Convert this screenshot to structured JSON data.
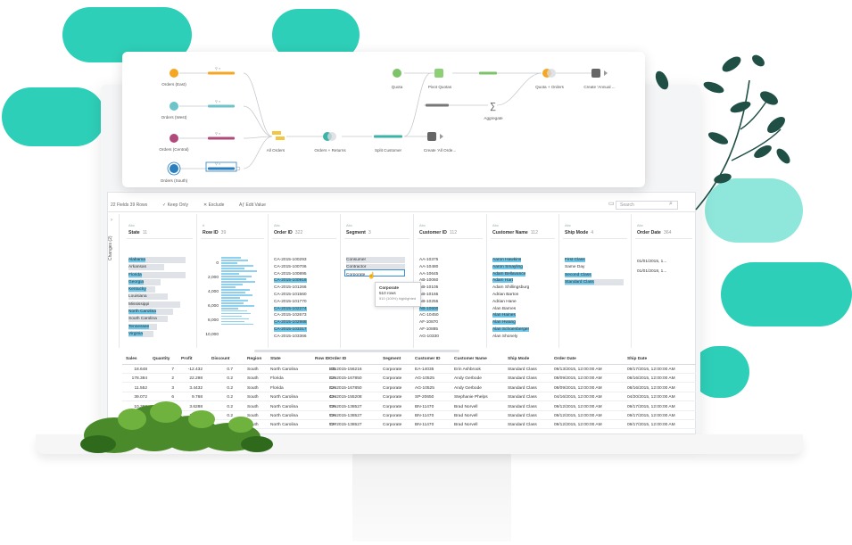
{
  "flow": {
    "inputs": [
      "Orders (East)",
      "Orders (West)",
      "Orders (Central)",
      "Orders (South)"
    ],
    "nodes": {
      "all_orders": "All Orders",
      "orders_returns": "Orders + Returns",
      "split_customer": "Split Customer",
      "create_all_orders": "Create 'All Orde...",
      "quota": "Quota",
      "pivot_quotas": "Pivot Quotas",
      "aggregate": "Aggregate",
      "quota_orders": "Quota + Orders",
      "create_annual": "Create 'Annual ..."
    }
  },
  "toolbar": {
    "counts": "22 Fields 39 Rows",
    "keep_only": "Keep Only",
    "exclude": "Exclude",
    "edit_value": "Edit Value",
    "search_placeholder": "Search"
  },
  "changes_tab": {
    "label": "Changes (2)"
  },
  "profile": {
    "state": {
      "type": "Abc",
      "title": "State",
      "count": "11",
      "values": [
        "Alabama",
        "Arkansas",
        "Florida",
        "Georgia",
        "Kentucky",
        "Louisiana",
        "Mississippi",
        "North Carolina",
        "South Carolina",
        "Tennessee",
        "Virginia"
      ]
    },
    "row_id": {
      "type": "#",
      "title": "Row ID",
      "count": "39",
      "values": [
        "0",
        "2,000",
        "4,000",
        "6,000",
        "8,000",
        "10,000"
      ]
    },
    "order_id": {
      "type": "Abc",
      "title": "Order ID",
      "count": "322",
      "values": [
        "CA-2015-100293",
        "CA-2015-100706",
        "CA-2015-100895",
        "CA-2015-100916",
        "CA-2015-101266",
        "CA-2015-101560",
        "CA-2015-101770",
        "CA-2015-102274",
        "CA-2015-102673",
        "CA-2015-102988",
        "CA-2015-103317",
        "CA-2015-103366"
      ]
    },
    "segment": {
      "type": "Abc",
      "title": "Segment",
      "count": "3",
      "values": [
        "Consumer",
        "Contractor",
        "Corporate"
      ]
    },
    "customer_id": {
      "type": "Abc",
      "title": "Customer ID",
      "count": "112",
      "values": [
        "AA-10375",
        "AA-10480",
        "AA-10645",
        "AB-10060",
        "AB-10105",
        "AB-10165",
        "AB-10255",
        "AB-10600",
        "AC-10450",
        "AF-10870",
        "AF-10885",
        "AG-10330"
      ]
    },
    "customer_name": {
      "type": "Abc",
      "title": "Customer Name",
      "count": "112",
      "values": [
        "Aaron Hawkins",
        "Aaron Smayling",
        "Adam Bellavance",
        "Adam Hart",
        "Adam Shillingsburg",
        "Adrian Barton",
        "Adrian Hane",
        "Alan Barnes",
        "Alan Haines",
        "Alan Hwang",
        "Alan Schoenberger",
        "Alan Shonely"
      ]
    },
    "ship_mode": {
      "type": "Abc",
      "title": "Ship Mode",
      "count": "4",
      "values": [
        "First Class",
        "Same Day",
        "Second Class",
        "Standard Class"
      ]
    },
    "order_date": {
      "type": "Abc",
      "title": "Order Date",
      "count": "364",
      "values": [
        "01/01/2015, 1...",
        "01/01/2018, 1..."
      ]
    }
  },
  "tooltip": {
    "title": "Corporate",
    "rows": "510 rows",
    "pct": "510 (100%) highlighted"
  },
  "grid": {
    "headers": [
      "Sales",
      "Quantity",
      "Profit",
      "Discount",
      "Region",
      "State",
      "Row ID",
      "Order ID",
      "Segment",
      "Customer ID",
      "Customer Name",
      "Ship Mode",
      "Order Date",
      "Ship Date"
    ],
    "rows": [
      [
        "18.648",
        "7",
        "-12.432",
        "0.7",
        "South",
        "North Carolina",
        "231",
        "US-2015-156216",
        "Corporate",
        "EA-14035",
        "Erin Ashbrook",
        "Standard Class",
        "09/13/2015, 12:00:00 AM",
        "09/17/2015, 12:00:00 AM"
      ],
      [
        "178.384",
        "2",
        "22.298",
        "0.2",
        "South",
        "Florida",
        "315",
        "CA-2015-167850",
        "Corporate",
        "AG-10525",
        "Andy Gerbode",
        "Standard Class",
        "08/09/2015, 12:00:00 AM",
        "08/16/2015, 12:00:00 AM"
      ],
      [
        "11.552",
        "3",
        "3.4432",
        "0.2",
        "South",
        "Florida",
        "316",
        "CA-2015-167850",
        "Corporate",
        "AG-10525",
        "Andy Gerbode",
        "Standard Class",
        "08/09/2015, 12:00:00 AM",
        "08/16/2015, 12:00:00 AM"
      ],
      [
        "39.072",
        "6",
        "9.768",
        "0.2",
        "South",
        "North Carolina",
        "404",
        "CA-2015-155208",
        "Corporate",
        "SP-20650",
        "Stephanie Phelps",
        "Standard Class",
        "04/16/2015, 12:00:00 AM",
        "04/20/2015, 12:00:00 AM"
      ],
      [
        "10.368",
        "2",
        "3.6288",
        "0.2",
        "South",
        "North Carolina",
        "705",
        "CA-2015-138527",
        "Corporate",
        "BN-11470",
        "Brad Norvell",
        "Standard Class",
        "09/12/2015, 12:00:00 AM",
        "09/17/2015, 12:00:00 AM"
      ],
      [
        "12.7680",
        "1",
        "1.7680",
        "0.2",
        "South",
        "North Carolina",
        "706",
        "CA-2015-138527",
        "Corporate",
        "BN-11470",
        "Brad Norvell",
        "Standard Class",
        "09/12/2015, 12:00:00 AM",
        "09/17/2015, 12:00:00 AM"
      ],
      [
        "8.9024",
        "",
        "",
        "",
        "South",
        "North Carolina",
        "707",
        "CA-2015-138527",
        "Corporate",
        "BN-11470",
        "Brad Norvell",
        "Standard Class",
        "09/12/2015, 12:00:00 AM",
        "09/17/2015, 12:00:00 AM"
      ]
    ]
  },
  "colors": {
    "accent": "#2ecfb8",
    "highlight": "#6ec7e8",
    "leaf": "#1f4f45"
  }
}
